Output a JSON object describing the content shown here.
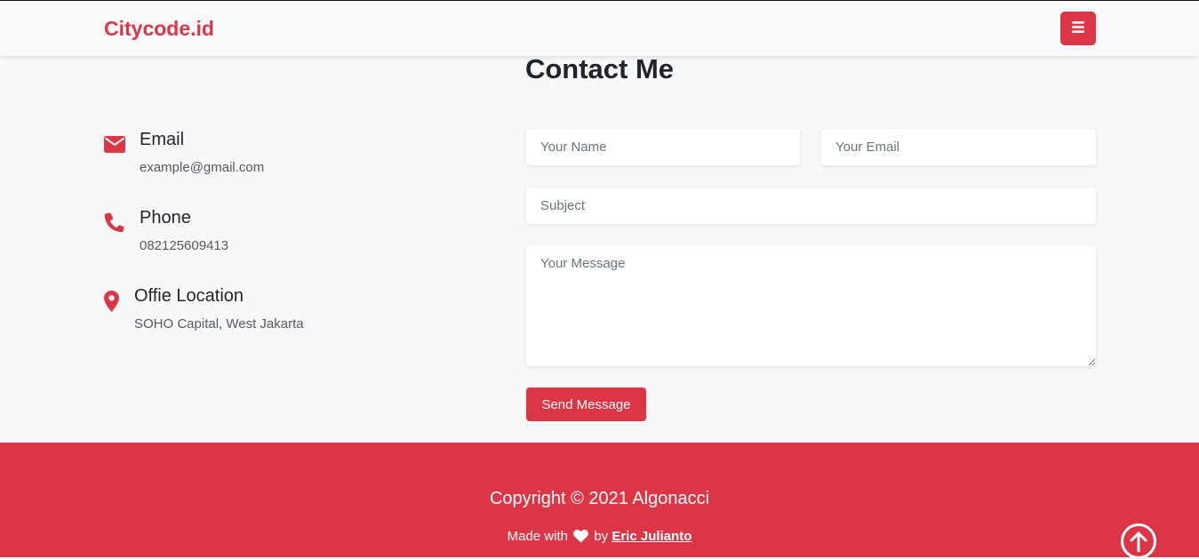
{
  "navbar": {
    "brand": "Citycode.id",
    "menu_icon": "bars-icon",
    "brand_color": "#dc3545"
  },
  "contact": {
    "title": "Contact Me",
    "info": [
      {
        "icon": "envelope-icon",
        "label": "Email",
        "value": "example@gmail.com"
      },
      {
        "icon": "phone-icon",
        "label": "Phone",
        "value": "082125609413"
      },
      {
        "icon": "map-marker-icon",
        "label": "Offie Location",
        "value": "SOHO Capital, West Jakarta"
      }
    ],
    "form": {
      "name_placeholder": "Your Name",
      "email_placeholder": "Your Email",
      "subject_placeholder": "Subject",
      "message_placeholder": "Your Message",
      "send_label": "Send Message"
    }
  },
  "footer": {
    "copyright": "Copyright © 2021 Algonacci",
    "made_with": "Made with",
    "by": "by",
    "author": "Eric Julianto",
    "heart_icon": "heart-icon",
    "back_to_top_icon": "arrow-up-circle-icon"
  }
}
